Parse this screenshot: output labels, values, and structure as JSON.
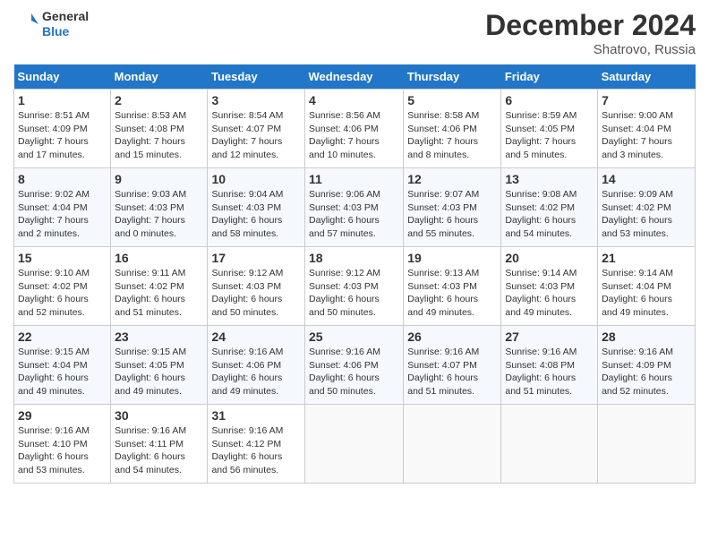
{
  "header": {
    "logo_line1": "General",
    "logo_line2": "Blue",
    "month_title": "December 2024",
    "subtitle": "Shatrovo, Russia"
  },
  "weekdays": [
    "Sunday",
    "Monday",
    "Tuesday",
    "Wednesday",
    "Thursday",
    "Friday",
    "Saturday"
  ],
  "days": [
    {
      "num": "",
      "info": ""
    },
    {
      "num": "",
      "info": ""
    },
    {
      "num": "",
      "info": ""
    },
    {
      "num": "1",
      "info": "Sunrise: 8:51 AM\nSunset: 4:09 PM\nDaylight: 7 hours\nand 17 minutes."
    },
    {
      "num": "2",
      "info": "Sunrise: 8:53 AM\nSunset: 4:08 PM\nDaylight: 7 hours\nand 15 minutes."
    },
    {
      "num": "3",
      "info": "Sunrise: 8:54 AM\nSunset: 4:07 PM\nDaylight: 7 hours\nand 12 minutes."
    },
    {
      "num": "4",
      "info": "Sunrise: 8:56 AM\nSunset: 4:06 PM\nDaylight: 7 hours\nand 10 minutes."
    },
    {
      "num": "5",
      "info": "Sunrise: 8:58 AM\nSunset: 4:06 PM\nDaylight: 7 hours\nand 8 minutes."
    },
    {
      "num": "6",
      "info": "Sunrise: 8:59 AM\nSunset: 4:05 PM\nDaylight: 7 hours\nand 5 minutes."
    },
    {
      "num": "7",
      "info": "Sunrise: 9:00 AM\nSunset: 4:04 PM\nDaylight: 7 hours\nand 3 minutes."
    },
    {
      "num": "8",
      "info": "Sunrise: 9:02 AM\nSunset: 4:04 PM\nDaylight: 7 hours\nand 2 minutes."
    },
    {
      "num": "9",
      "info": "Sunrise: 9:03 AM\nSunset: 4:03 PM\nDaylight: 7 hours\nand 0 minutes."
    },
    {
      "num": "10",
      "info": "Sunrise: 9:04 AM\nSunset: 4:03 PM\nDaylight: 6 hours\nand 58 minutes."
    },
    {
      "num": "11",
      "info": "Sunrise: 9:06 AM\nSunset: 4:03 PM\nDaylight: 6 hours\nand 57 minutes."
    },
    {
      "num": "12",
      "info": "Sunrise: 9:07 AM\nSunset: 4:03 PM\nDaylight: 6 hours\nand 55 minutes."
    },
    {
      "num": "13",
      "info": "Sunrise: 9:08 AM\nSunset: 4:02 PM\nDaylight: 6 hours\nand 54 minutes."
    },
    {
      "num": "14",
      "info": "Sunrise: 9:09 AM\nSunset: 4:02 PM\nDaylight: 6 hours\nand 53 minutes."
    },
    {
      "num": "15",
      "info": "Sunrise: 9:10 AM\nSunset: 4:02 PM\nDaylight: 6 hours\nand 52 minutes."
    },
    {
      "num": "16",
      "info": "Sunrise: 9:11 AM\nSunset: 4:02 PM\nDaylight: 6 hours\nand 51 minutes."
    },
    {
      "num": "17",
      "info": "Sunrise: 9:12 AM\nSunset: 4:03 PM\nDaylight: 6 hours\nand 50 minutes."
    },
    {
      "num": "18",
      "info": "Sunrise: 9:12 AM\nSunset: 4:03 PM\nDaylight: 6 hours\nand 50 minutes."
    },
    {
      "num": "19",
      "info": "Sunrise: 9:13 AM\nSunset: 4:03 PM\nDaylight: 6 hours\nand 49 minutes."
    },
    {
      "num": "20",
      "info": "Sunrise: 9:14 AM\nSunset: 4:03 PM\nDaylight: 6 hours\nand 49 minutes."
    },
    {
      "num": "21",
      "info": "Sunrise: 9:14 AM\nSunset: 4:04 PM\nDaylight: 6 hours\nand 49 minutes."
    },
    {
      "num": "22",
      "info": "Sunrise: 9:15 AM\nSunset: 4:04 PM\nDaylight: 6 hours\nand 49 minutes."
    },
    {
      "num": "23",
      "info": "Sunrise: 9:15 AM\nSunset: 4:05 PM\nDaylight: 6 hours\nand 49 minutes."
    },
    {
      "num": "24",
      "info": "Sunrise: 9:16 AM\nSunset: 4:06 PM\nDaylight: 6 hours\nand 49 minutes."
    },
    {
      "num": "25",
      "info": "Sunrise: 9:16 AM\nSunset: 4:06 PM\nDaylight: 6 hours\nand 50 minutes."
    },
    {
      "num": "26",
      "info": "Sunrise: 9:16 AM\nSunset: 4:07 PM\nDaylight: 6 hours\nand 51 minutes."
    },
    {
      "num": "27",
      "info": "Sunrise: 9:16 AM\nSunset: 4:08 PM\nDaylight: 6 hours\nand 51 minutes."
    },
    {
      "num": "28",
      "info": "Sunrise: 9:16 AM\nSunset: 4:09 PM\nDaylight: 6 hours\nand 52 minutes."
    },
    {
      "num": "29",
      "info": "Sunrise: 9:16 AM\nSunset: 4:10 PM\nDaylight: 6 hours\nand 53 minutes."
    },
    {
      "num": "30",
      "info": "Sunrise: 9:16 AM\nSunset: 4:11 PM\nDaylight: 6 hours\nand 54 minutes."
    },
    {
      "num": "31",
      "info": "Sunrise: 9:16 AM\nSunset: 4:12 PM\nDaylight: 6 hours\nand 56 minutes."
    },
    {
      "num": "",
      "info": ""
    },
    {
      "num": "",
      "info": ""
    },
    {
      "num": "",
      "info": ""
    },
    {
      "num": "",
      "info": ""
    }
  ]
}
